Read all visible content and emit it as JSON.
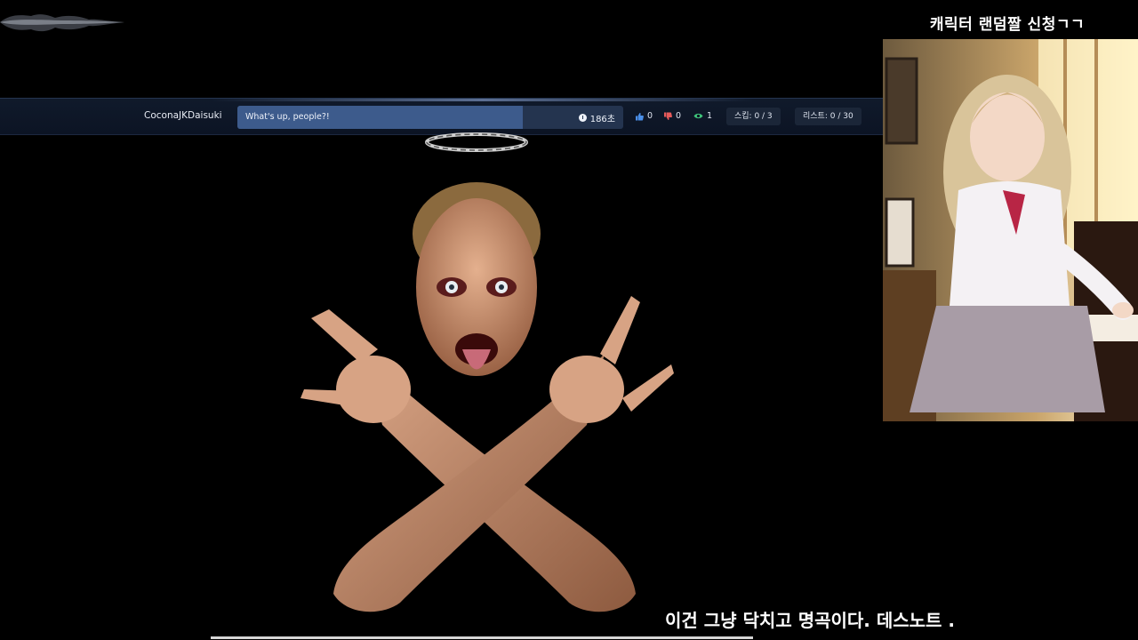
{
  "player": {
    "username": "CoconaJKDaisuki",
    "track_title": "What's up, people?!",
    "remaining_time": "186초",
    "progress_fraction": 0.74,
    "likes": "0",
    "dislikes": "0",
    "viewers": "1",
    "skip_label": "스킵: 0 / 3",
    "list_label": "리스트: 0 / 30"
  },
  "side_panel": {
    "title": "캐릭터 랜덤짤 신청ㄱㄱ"
  },
  "subtitle": "이건 그냥 닥치고 명곡이다. 데스노트 .",
  "colors": {
    "bar_bg": "#0c1424",
    "progress_bg": "#24344f",
    "progress_fill": "#3d5b8c",
    "like": "#4a8fe8",
    "dislike": "#e55a5a",
    "viewer": "#3ec47a"
  },
  "icons": [
    "clock-icon",
    "thumbs-up-icon",
    "thumbs-down-icon",
    "eye-icon"
  ]
}
